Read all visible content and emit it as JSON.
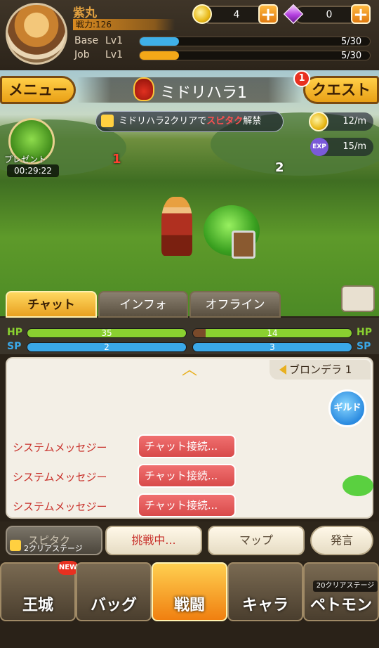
{
  "player": {
    "name": "紫丸",
    "power": "戦力:126"
  },
  "resources": {
    "coins": "4",
    "gems": "0"
  },
  "levels": {
    "base_label": "Base",
    "base_level": "Lv1",
    "base_exp": "5/30",
    "base_fraction": 0.17,
    "job_label": "Job",
    "job_level": "Lv1",
    "job_exp": "5/30",
    "job_fraction": 0.17
  },
  "scene": {
    "menu_label": "メニュー",
    "quest_label": "クエスト",
    "quest_badge": "1",
    "stage_title": "ミドリハラ1",
    "unlock_prefix": "ミドリハラ2クリアで",
    "unlock_highlight": "スピタク",
    "unlock_suffix": "解禁",
    "coin_rate": "12/m",
    "exp_rate": "15/m",
    "exp_badge": "EXP",
    "present_label": "プレゼント",
    "present_timer": "00:29:22",
    "wave_left": "1",
    "wave_right": "2"
  },
  "tabs": [
    {
      "label": "チャット",
      "active": true
    },
    {
      "label": "インフォ",
      "active": false
    },
    {
      "label": "オフライン",
      "active": false
    }
  ],
  "stats": {
    "hp_label": "HP",
    "sp_label": "SP",
    "player_hp": "35",
    "player_sp": "2",
    "enemy_hp": "14",
    "enemy_sp": "3"
  },
  "chat": {
    "channel": "ブロンデラ 1",
    "guild_button": "ギルド",
    "messages": [
      {
        "sender": "システムメッセジー",
        "text": "チャット接続..."
      },
      {
        "sender": "システムメッセジー",
        "text": "チャット接続..."
      },
      {
        "sender": "システムメッセジー",
        "text": "チャット接続..."
      }
    ]
  },
  "actions": {
    "spectate": "スピタク",
    "spectate_note": "2クリアステージ",
    "challenge": "挑戦中...",
    "map": "マップ",
    "speak": "発言"
  },
  "nav": {
    "castle": "王城",
    "bag": "バッグ",
    "battle": "戦闘",
    "chara": "キャラ",
    "petmon": "ペトモン",
    "new_badge": "NEW",
    "pet_note": "20クリアステージ"
  },
  "colors": {
    "hp": "#8ad030",
    "sp": "#3aa8e8",
    "accent": "#f0a018",
    "chat_red": "#d84a4a"
  }
}
